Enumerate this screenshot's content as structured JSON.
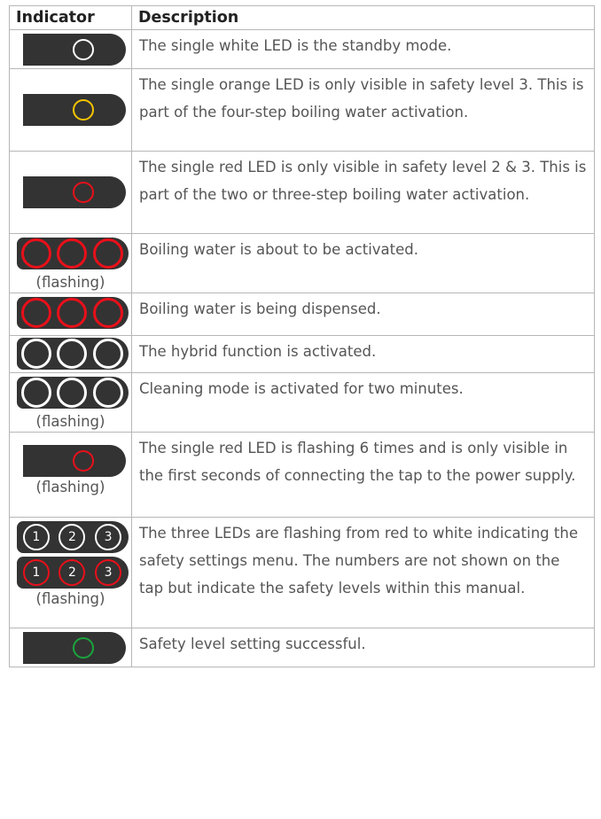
{
  "header": {
    "indicator": "Indicator",
    "description": "Description"
  },
  "colors": {
    "white": "#ffffff",
    "orange": "#f5c400",
    "red": "#e8101a",
    "green": "#19a53c",
    "pill": "#333333"
  },
  "rows": [
    {
      "icon": "white-led-icon",
      "description": "The single white LED is the standby mode."
    },
    {
      "icon": "orange-led-icon",
      "description": "The single orange LED is only visible in safety level 3. This is part of the four-step boiling water activation."
    },
    {
      "icon": "red-led-icon",
      "description": "The single red LED is only visible in safety level 2 & 3. This is part of the two or three-step boiling water activation."
    },
    {
      "icon": "three-red-leds-icon",
      "note": "(flashing)",
      "description": "Boiling water is about to be activated."
    },
    {
      "icon": "three-red-leds-icon",
      "description": "Boiling water is being dispensed."
    },
    {
      "icon": "three-white-leds-icon",
      "description": "The hybrid function is activated."
    },
    {
      "icon": "three-white-leds-icon",
      "note": "(flashing)",
      "description": "Cleaning mode is activated for two minutes."
    },
    {
      "icon": "red-led-icon",
      "note": "(flashing)",
      "description": "The single red LED is flashing 6 times and is only visible in the first seconds of connecting the tap to the power supply."
    },
    {
      "icon": "numbered-leds-icon",
      "numbers": [
        "1",
        "2",
        "3"
      ],
      "note": "(flashing)",
      "description": "The three LEDs are flashing from red to white indicating the safety settings menu. The numbers are not shown on the tap but indicate the safety levels within this manual."
    },
    {
      "icon": "green-led-icon",
      "description": "Safety level setting successful."
    }
  ]
}
